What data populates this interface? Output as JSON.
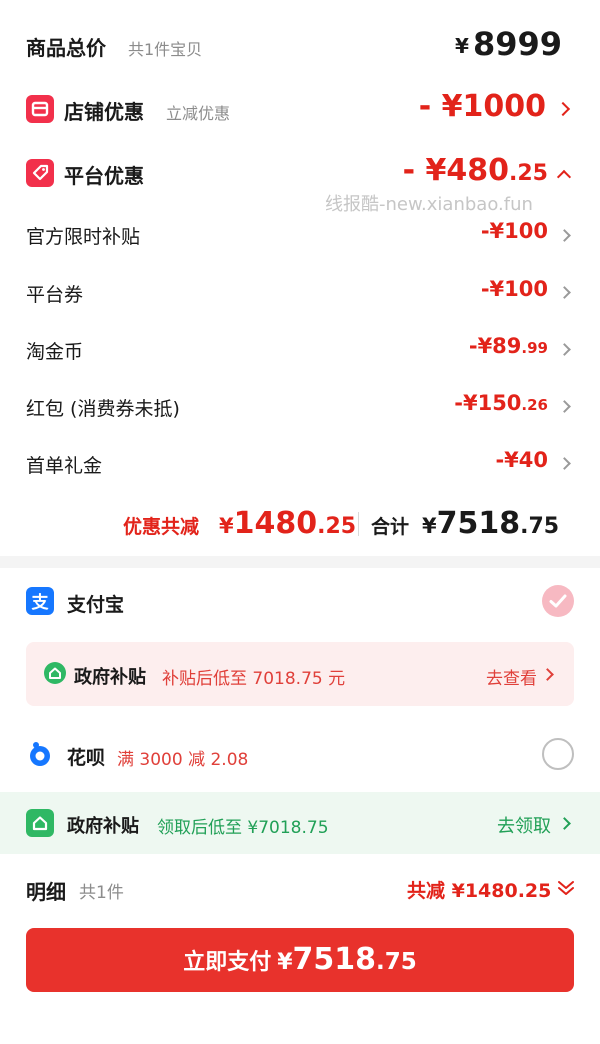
{
  "summary": {
    "total_label": "商品总价",
    "total_count": "共1件宝贝",
    "total_currency": "¥",
    "total_value": "8999",
    "store_label": "店铺优惠",
    "store_note": "立减优惠",
    "store_value": "- ¥1000",
    "platform_label": "平台优惠",
    "platform_value_int": "- ¥480",
    "platform_value_dec": ".25",
    "watermark": "线报酷-new.xianbao.fun"
  },
  "discounts": [
    {
      "label": "官方限时补贴",
      "int": "-¥100",
      "dec": ""
    },
    {
      "label": "平台券",
      "int": "-¥100",
      "dec": ""
    },
    {
      "label": "淘金币",
      "int": "-¥89",
      "dec": ".99"
    },
    {
      "label": "红包 (消费券未抵)",
      "int": "-¥150",
      "dec": ".26"
    },
    {
      "label": "首单礼金",
      "int": "-¥40",
      "dec": ""
    }
  ],
  "totals": {
    "saved_label": "优惠共减",
    "saved_currency": "¥",
    "saved_int": "1480",
    "saved_dec": ".25",
    "sum_label": "合计",
    "sum_currency": "¥",
    "sum_int": "7518",
    "sum_dec": ".75"
  },
  "payment": {
    "alipay_label": "支付宝",
    "gov1_label": "政府补贴",
    "gov1_text": "补贴后低至 7018.75 元",
    "gov1_link": "去查看",
    "huabei_label": "花呗",
    "huabei_promo": "满 3000 减 2.08",
    "gov2_label": "政府补贴",
    "gov2_text": "领取后低至 ¥7018.75",
    "gov2_link": "去领取"
  },
  "detail": {
    "label": "明细",
    "count": "共1件",
    "saved": "共减 ¥1480.25"
  },
  "pay_button": {
    "label": "立即支付",
    "currency": "¥",
    "int": "7518",
    "dec": ".75"
  },
  "colors": {
    "accent_red": "#e2231a",
    "alipay_blue": "#1677ff",
    "subsidy_green": "#21a057"
  }
}
